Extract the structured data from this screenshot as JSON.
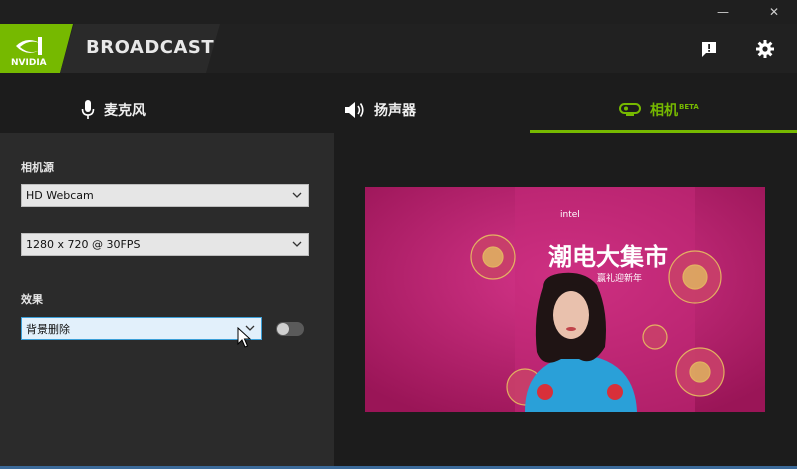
{
  "window": {
    "minimize_glyph": "—",
    "close_glyph": "✕"
  },
  "header": {
    "logo_text": "NVIDIA",
    "app_title": "BROADCAST",
    "brand_color": "#76b900",
    "icons": [
      "feedback-icon",
      "settings-gear-icon"
    ]
  },
  "tabs": [
    {
      "label": "麦克风",
      "icon": "microphone-icon",
      "active": false
    },
    {
      "label": "扬声器",
      "icon": "speaker-icon",
      "active": false
    },
    {
      "label": "相机",
      "badge": "BETA",
      "icon": "webcam-icon",
      "active": true
    }
  ],
  "camera_settings": {
    "source_label": "相机源",
    "source_value": "HD Webcam",
    "resolution_value": "1280 x 720 @ 30FPS",
    "effect_label": "效果",
    "effect_value": "背景删除",
    "effect_enabled": false
  },
  "preview": {
    "sign_text": "潮电大集市",
    "sign_subtext": "赢礼迎新年",
    "brand_text": "intel"
  }
}
